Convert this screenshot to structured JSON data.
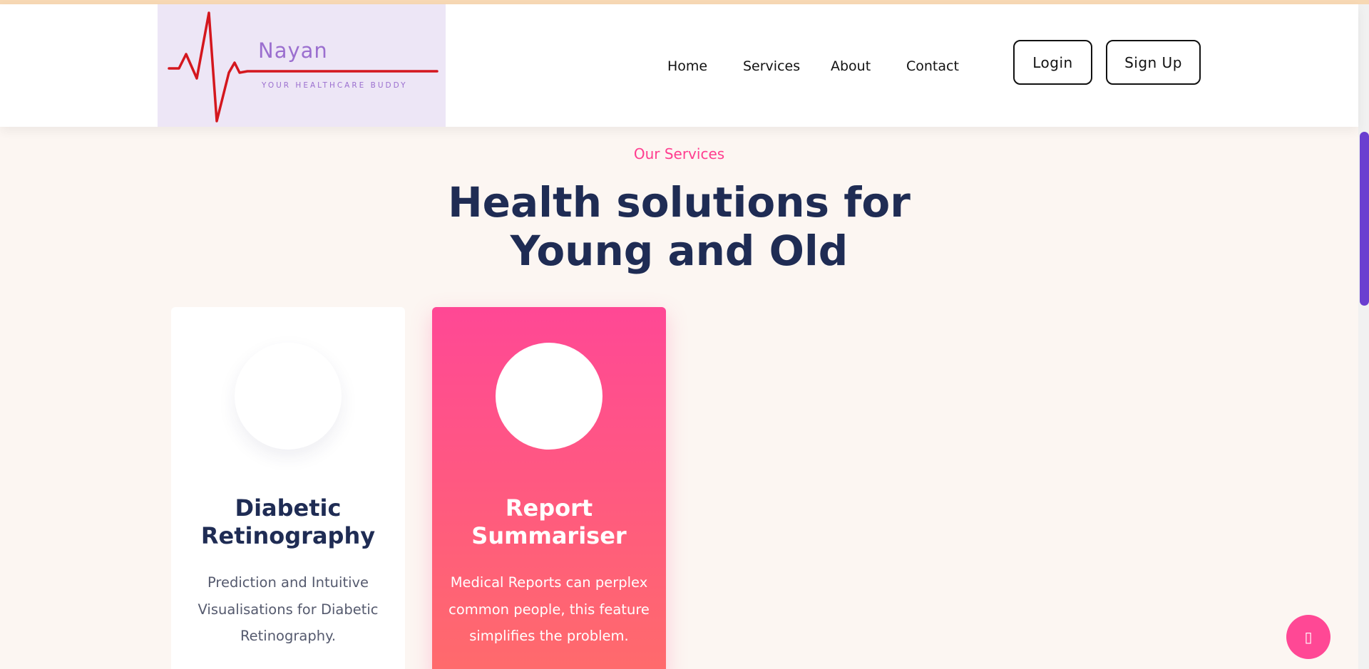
{
  "logo": {
    "name": "Nayan",
    "tagline": "YOUR HEALTHCARE BUDDY"
  },
  "nav": {
    "items": [
      "Home",
      "Services",
      "About",
      "Contact"
    ]
  },
  "auth": {
    "login_label": "Login",
    "signup_label": "Sign Up"
  },
  "services": {
    "label": "Our Services",
    "title_line1": "Health solutions for",
    "title_line2": "Young and Old",
    "cards": [
      {
        "title_line1": "Diabetic",
        "title_line2": "Retinography",
        "text": "Prediction and Intuitive Visualisations for Diabetic Retinography."
      },
      {
        "title_line1": "Report",
        "title_line2": "Summariser",
        "text": "Medical Reports can perplex common people, this feature simplifies the problem."
      }
    ]
  },
  "chat": {
    "icon": "chat-icon",
    "glyph": "▯"
  },
  "colors": {
    "accent_pink": "#ff4895",
    "title_navy": "#1f2c54",
    "logo_purple": "#9b6fcf",
    "ecg_red": "#d4171e",
    "scroll_purple": "#6a3fd0"
  }
}
